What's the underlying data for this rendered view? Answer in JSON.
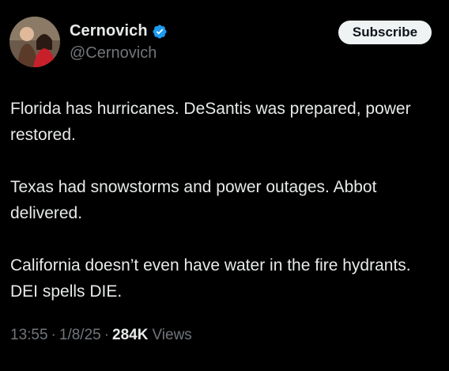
{
  "author": {
    "display_name": "Cernovich",
    "handle": "@Cernovich",
    "verified": true,
    "verified_color": "#1d9bf0"
  },
  "actions": {
    "subscribe_label": "Subscribe"
  },
  "tweet": {
    "paragraphs": [
      "Florida has hurricanes. DeSantis was prepared, power restored.",
      "Texas had snowstorms and power outages. Abbot delivered.",
      "California doesn’t even have water in the fire hydrants. DEI spells DIE."
    ]
  },
  "meta": {
    "time": "13:55",
    "date": "1/8/25",
    "separator": "·",
    "views_count": "284K",
    "views_label": "Views"
  }
}
